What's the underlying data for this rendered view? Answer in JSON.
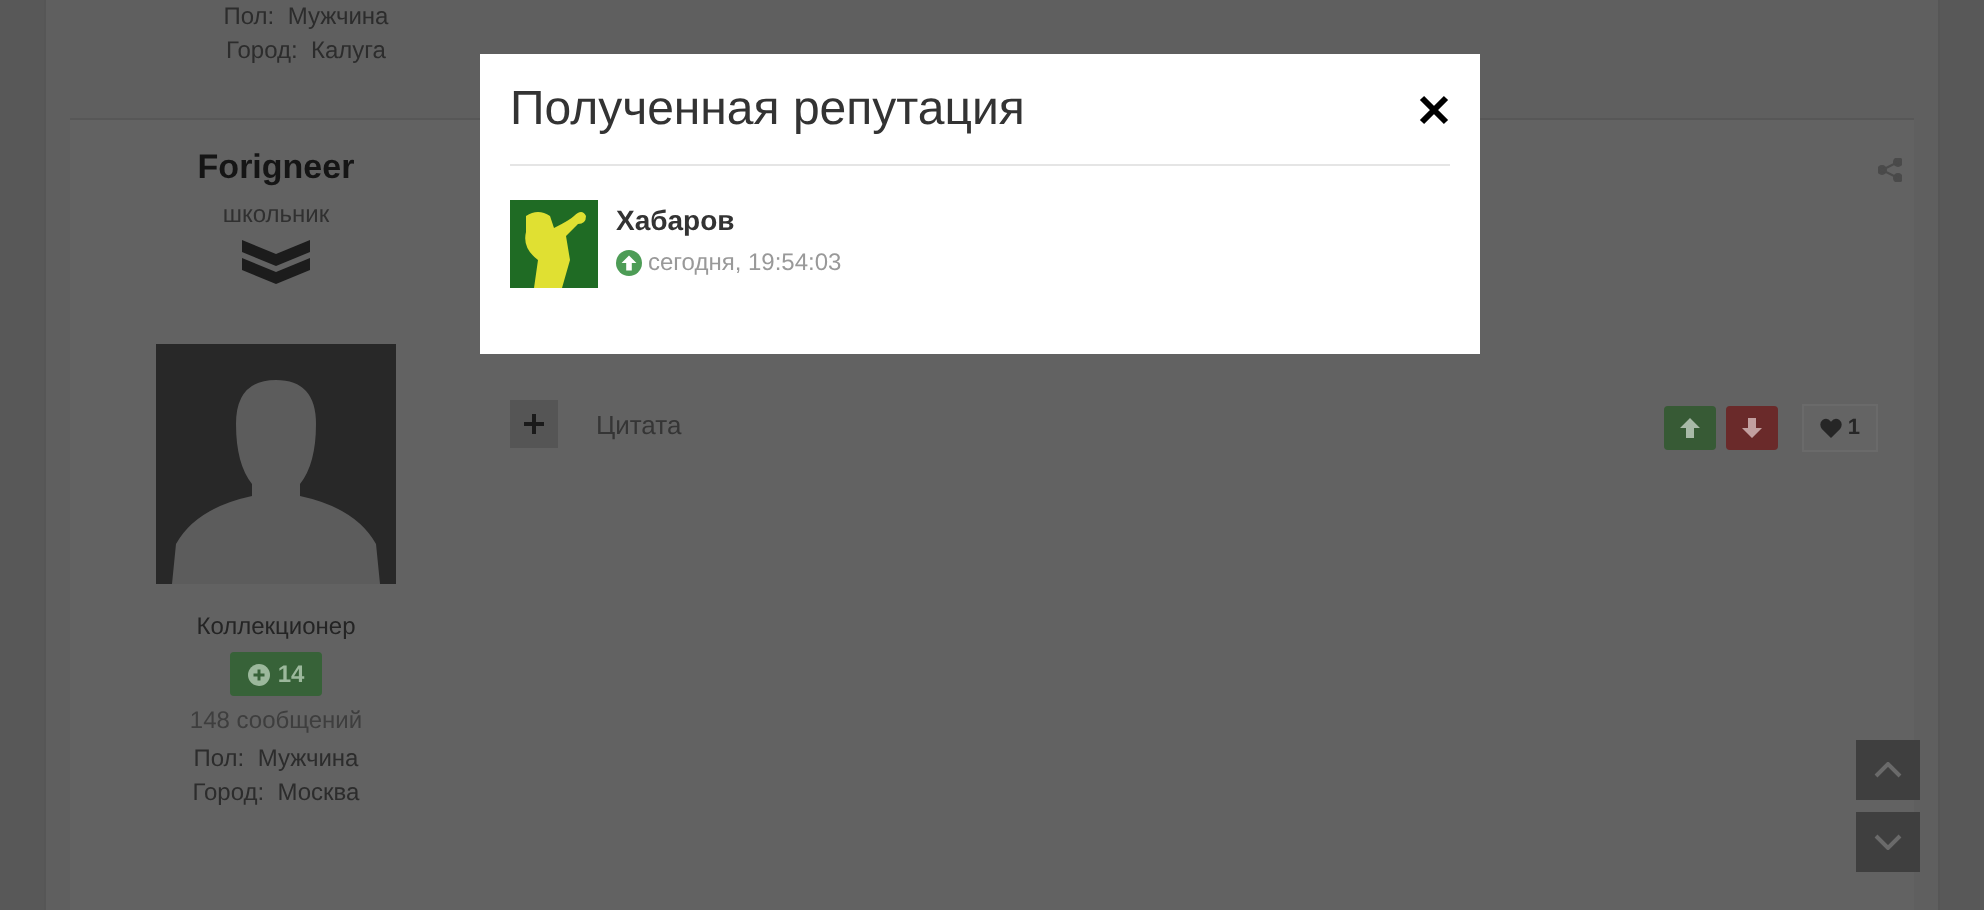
{
  "previous_post": {
    "info": [
      {
        "label": "Пол:",
        "value": "Мужчина"
      },
      {
        "label": "Город:",
        "value": "Калуга"
      }
    ]
  },
  "post": {
    "author": {
      "name": "Forigneer",
      "rank": "школьник",
      "title": "Коллекционер",
      "reputation": "14",
      "posts": "148 сообщений",
      "info": [
        {
          "label": "Пол:",
          "value": "Мужчина"
        },
        {
          "label": "Город:",
          "value": "Москва"
        }
      ]
    },
    "quote": "Цитата",
    "likes": "1"
  },
  "modal": {
    "title": "Полученная репутация",
    "entries": [
      {
        "name": "Хабаров",
        "kind": "up",
        "time": "сегодня, 19:54:03"
      }
    ]
  }
}
